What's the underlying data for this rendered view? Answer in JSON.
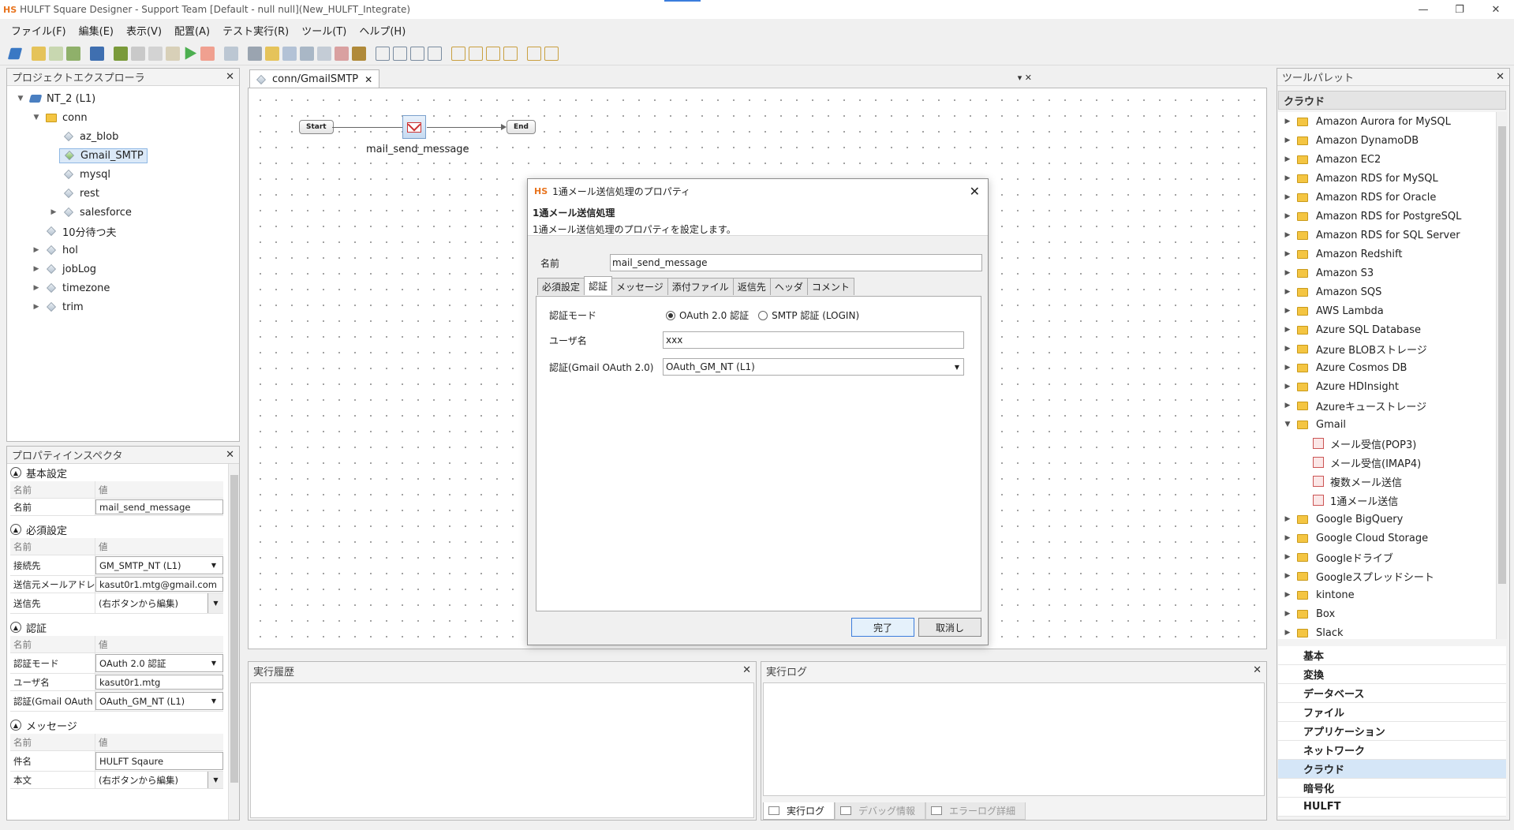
{
  "window": {
    "logo": "HS",
    "title": "HULFT Square Designer - Support Team [Default - null null](New_HULFT_Integrate)",
    "controls": [
      "—",
      "❐",
      "✕"
    ]
  },
  "menu": [
    "ファイル(F)",
    "編集(E)",
    "表示(V)",
    "配置(A)",
    "テスト実行(R)",
    "ツール(T)",
    "ヘルプ(H)"
  ],
  "explorer": {
    "title": "プロジェクトエクスプローラ",
    "root": "NT_2 (L1)",
    "folder": "conn",
    "conn_items": [
      "az_blob",
      "Gmail_SMTP",
      "mysql",
      "rest",
      "salesforce"
    ],
    "other_items": [
      "10分待つ夫",
      "hol",
      "jobLog",
      "timezone",
      "trim"
    ]
  },
  "inspector": {
    "title": "プロパティインスペクタ",
    "col_name": "名前",
    "col_value": "値",
    "basic": {
      "title": "基本設定",
      "name_label": "名前",
      "name_value": "mail_send_message"
    },
    "required": {
      "title": "必須設定",
      "conn_label": "接続先",
      "conn_value": "GM_SMTP_NT (L1)",
      "from_label": "送信元メールアドレ",
      "from_value": "kasut0r1.mtg@gmail.com",
      "to_label": "送信先",
      "to_value": "(右ボタンから編集)"
    },
    "auth": {
      "title": "認証",
      "mode_label": "認証モード",
      "mode_value": "OAuth 2.0 認証",
      "user_label": "ユーザ名",
      "user_value": "kasut0r1.mtg",
      "oauth_label": "認証(Gmail OAuth",
      "oauth_value": "OAuth_GM_NT (L1)"
    },
    "message": {
      "title": "メッセージ",
      "subject_label": "件名",
      "subject_value": "HULFT Sqaure",
      "body_label": "本文",
      "body_value": "(右ボタンから編集)"
    }
  },
  "editor": {
    "tab": "conn/GmailSMTP",
    "tab_close": "✕",
    "controls": "▾ ✕",
    "start": "Start",
    "end": "End",
    "node_label": "mail_send_message"
  },
  "history": {
    "title": "実行履歴"
  },
  "log": {
    "title": "実行ログ",
    "tabs": [
      "実行ログ",
      "デバッグ情報",
      "エラーログ詳細"
    ]
  },
  "palette": {
    "title": "ツールパレット",
    "section": "クラウド",
    "items": [
      "Amazon Aurora for MySQL",
      "Amazon DynamoDB",
      "Amazon EC2",
      "Amazon RDS for MySQL",
      "Amazon RDS for Oracle",
      "Amazon RDS for PostgreSQL",
      "Amazon RDS for SQL Server",
      "Amazon Redshift",
      "Amazon S3",
      "Amazon SQS",
      "AWS Lambda",
      "Azure SQL Database",
      "Azure BLOBストレージ",
      "Azure Cosmos DB",
      "Azure HDInsight",
      "Azureキューストレージ",
      "Gmail"
    ],
    "gmail_children": [
      "メール受信(POP3)",
      "メール受信(IMAP4)",
      "複数メール送信",
      "1通メール送信"
    ],
    "items_after": [
      "Google BigQuery",
      "Google Cloud Storage",
      "Googleドライブ",
      "Googleスプレッドシート",
      "kintone",
      "Box",
      "Slack"
    ],
    "categories": [
      "基本",
      "変換",
      "データベース",
      "ファイル",
      "アプリケーション",
      "ネットワーク",
      "クラウド",
      "暗号化",
      "HULFT"
    ],
    "active_category": "クラウド"
  },
  "dialog": {
    "logo": "HS",
    "title": "1通メール送信処理のプロパティ",
    "heading": "1通メール送信処理",
    "description": "1通メール送信処理のプロパティを設定します。",
    "name_label": "名前",
    "name_value": "mail_send_message",
    "tabs": [
      "必須設定",
      "認証",
      "メッセージ",
      "添付ファイル",
      "返信先",
      "ヘッダ",
      "コメント"
    ],
    "active_tab": "認証",
    "auth_mode_label": "認証モード",
    "auth_mode_options": [
      "OAuth 2.0 認証",
      "SMTP 認証 (LOGIN)"
    ],
    "user_label": "ユーザ名",
    "user_value": "xxx",
    "oauth_label": "認証(Gmail OAuth 2.0)",
    "oauth_value": "OAuth_GM_NT (L1)",
    "ok": "完了",
    "cancel": "取消し"
  }
}
